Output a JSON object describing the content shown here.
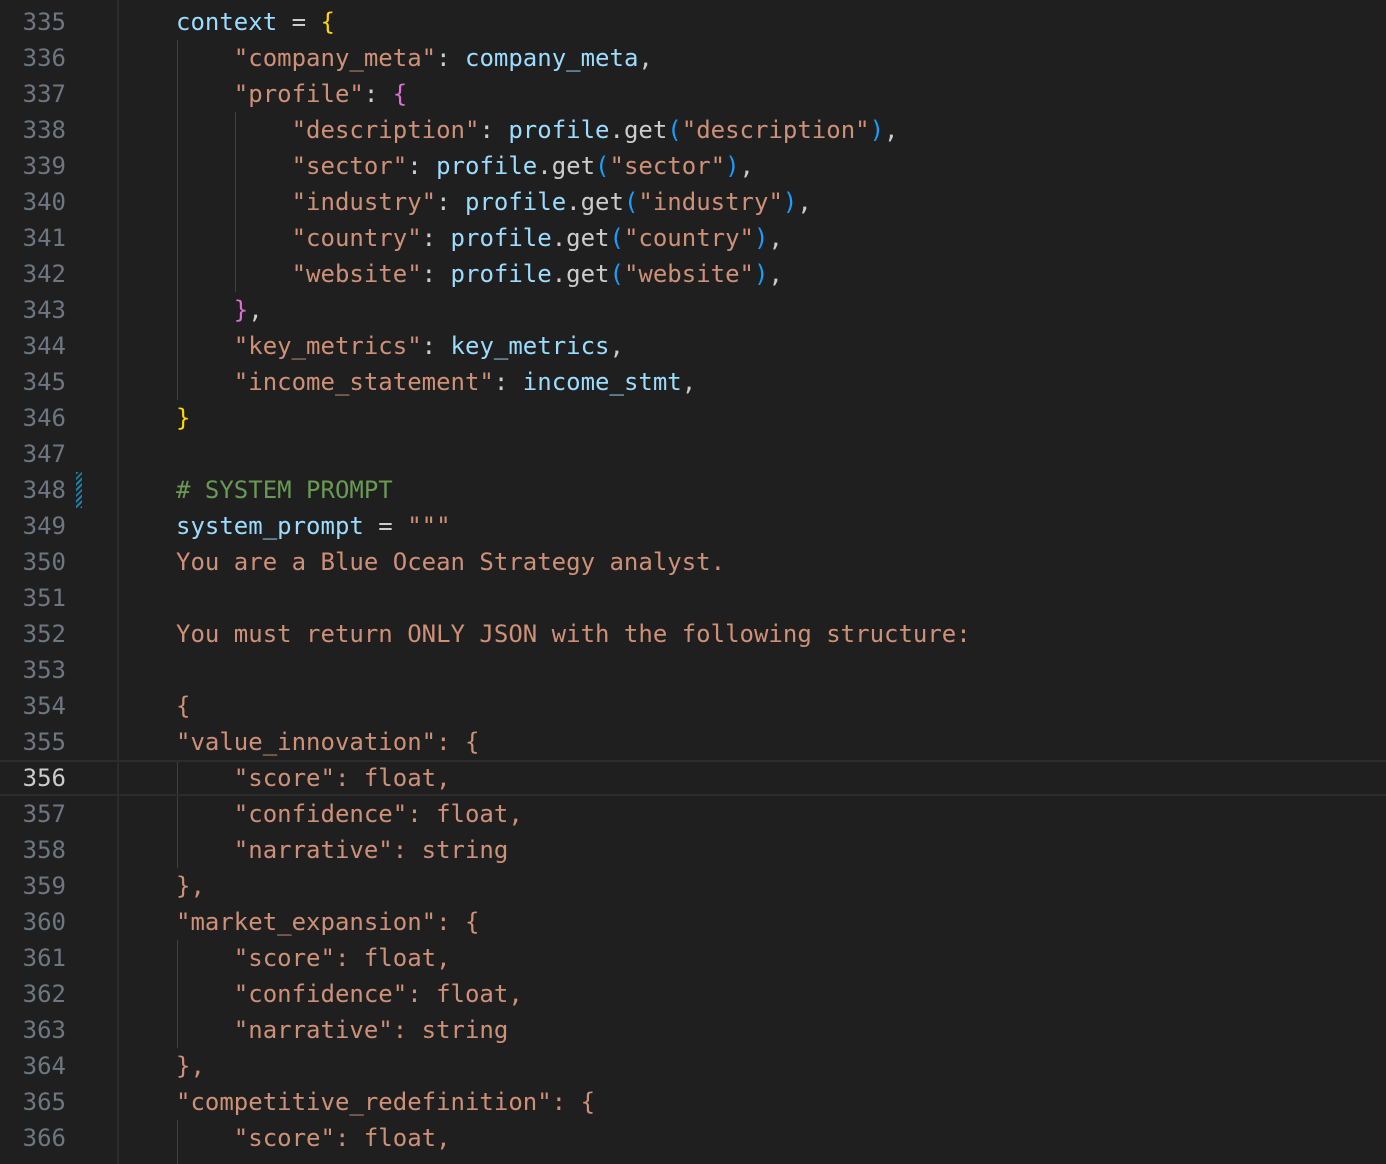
{
  "editor": {
    "language": "python",
    "current_line": 356,
    "modified_line": 348,
    "colors": {
      "background": "#1f1f1f",
      "line_number": "#6e7681",
      "active_line_number": "#cccccc",
      "variable": "#9cdcfe",
      "string": "#ce9178",
      "punctuation": "#cccccc",
      "bracket_level_1": "#ffd700",
      "bracket_level_2": "#da70d6",
      "bracket_level_3": "#179fff",
      "comment": "#6a9955",
      "modified_marker": "#1b81a8"
    },
    "lines": [
      {
        "number": "335",
        "tokens": [
          {
            "text": "context",
            "type": "v"
          },
          {
            "text": " = ",
            "type": "p"
          },
          {
            "text": "{",
            "type": "b1"
          }
        ]
      },
      {
        "number": "336",
        "tokens": [
          {
            "text": "    ",
            "type": "p"
          },
          {
            "text": "\"company_meta\"",
            "type": "s"
          },
          {
            "text": ": ",
            "type": "p"
          },
          {
            "text": "company_meta",
            "type": "v"
          },
          {
            "text": ",",
            "type": "p"
          }
        ]
      },
      {
        "number": "337",
        "tokens": [
          {
            "text": "    ",
            "type": "p"
          },
          {
            "text": "\"profile\"",
            "type": "s"
          },
          {
            "text": ": ",
            "type": "p"
          },
          {
            "text": "{",
            "type": "b2"
          }
        ]
      },
      {
        "number": "338",
        "tokens": [
          {
            "text": "        ",
            "type": "p"
          },
          {
            "text": "\"description\"",
            "type": "s"
          },
          {
            "text": ": ",
            "type": "p"
          },
          {
            "text": "profile",
            "type": "v"
          },
          {
            "text": ".get",
            "type": "p"
          },
          {
            "text": "(",
            "type": "b3"
          },
          {
            "text": "\"description\"",
            "type": "s"
          },
          {
            "text": ")",
            "type": "b3"
          },
          {
            "text": ",",
            "type": "p"
          }
        ]
      },
      {
        "number": "339",
        "tokens": [
          {
            "text": "        ",
            "type": "p"
          },
          {
            "text": "\"sector\"",
            "type": "s"
          },
          {
            "text": ": ",
            "type": "p"
          },
          {
            "text": "profile",
            "type": "v"
          },
          {
            "text": ".get",
            "type": "p"
          },
          {
            "text": "(",
            "type": "b3"
          },
          {
            "text": "\"sector\"",
            "type": "s"
          },
          {
            "text": ")",
            "type": "b3"
          },
          {
            "text": ",",
            "type": "p"
          }
        ]
      },
      {
        "number": "340",
        "tokens": [
          {
            "text": "        ",
            "type": "p"
          },
          {
            "text": "\"industry\"",
            "type": "s"
          },
          {
            "text": ": ",
            "type": "p"
          },
          {
            "text": "profile",
            "type": "v"
          },
          {
            "text": ".get",
            "type": "p"
          },
          {
            "text": "(",
            "type": "b3"
          },
          {
            "text": "\"industry\"",
            "type": "s"
          },
          {
            "text": ")",
            "type": "b3"
          },
          {
            "text": ",",
            "type": "p"
          }
        ]
      },
      {
        "number": "341",
        "tokens": [
          {
            "text": "        ",
            "type": "p"
          },
          {
            "text": "\"country\"",
            "type": "s"
          },
          {
            "text": ": ",
            "type": "p"
          },
          {
            "text": "profile",
            "type": "v"
          },
          {
            "text": ".get",
            "type": "p"
          },
          {
            "text": "(",
            "type": "b3"
          },
          {
            "text": "\"country\"",
            "type": "s"
          },
          {
            "text": ")",
            "type": "b3"
          },
          {
            "text": ",",
            "type": "p"
          }
        ]
      },
      {
        "number": "342",
        "tokens": [
          {
            "text": "        ",
            "type": "p"
          },
          {
            "text": "\"website\"",
            "type": "s"
          },
          {
            "text": ": ",
            "type": "p"
          },
          {
            "text": "profile",
            "type": "v"
          },
          {
            "text": ".get",
            "type": "p"
          },
          {
            "text": "(",
            "type": "b3"
          },
          {
            "text": "\"website\"",
            "type": "s"
          },
          {
            "text": ")",
            "type": "b3"
          },
          {
            "text": ",",
            "type": "p"
          }
        ]
      },
      {
        "number": "343",
        "tokens": [
          {
            "text": "    ",
            "type": "p"
          },
          {
            "text": "}",
            "type": "b2"
          },
          {
            "text": ",",
            "type": "p"
          }
        ]
      },
      {
        "number": "344",
        "tokens": [
          {
            "text": "    ",
            "type": "p"
          },
          {
            "text": "\"key_metrics\"",
            "type": "s"
          },
          {
            "text": ": ",
            "type": "p"
          },
          {
            "text": "key_metrics",
            "type": "v"
          },
          {
            "text": ",",
            "type": "p"
          }
        ]
      },
      {
        "number": "345",
        "tokens": [
          {
            "text": "    ",
            "type": "p"
          },
          {
            "text": "\"income_statement\"",
            "type": "s"
          },
          {
            "text": ": ",
            "type": "p"
          },
          {
            "text": "income_stmt",
            "type": "v"
          },
          {
            "text": ",",
            "type": "p"
          }
        ]
      },
      {
        "number": "346",
        "tokens": [
          {
            "text": "}",
            "type": "b1"
          }
        ]
      },
      {
        "number": "347",
        "tokens": []
      },
      {
        "number": "348",
        "tokens": [
          {
            "text": "# SYSTEM PROMPT",
            "type": "cm"
          }
        ]
      },
      {
        "number": "349",
        "tokens": [
          {
            "text": "system_prompt",
            "type": "v"
          },
          {
            "text": " = ",
            "type": "p"
          },
          {
            "text": "\"\"\"",
            "type": "s"
          }
        ]
      },
      {
        "number": "350",
        "tokens": [
          {
            "text": "You are a Blue Ocean Strategy analyst.",
            "type": "s"
          }
        ]
      },
      {
        "number": "351",
        "tokens": []
      },
      {
        "number": "352",
        "tokens": [
          {
            "text": "You must return ONLY JSON with the following structure:",
            "type": "s"
          }
        ]
      },
      {
        "number": "353",
        "tokens": []
      },
      {
        "number": "354",
        "tokens": [
          {
            "text": "{",
            "type": "s"
          }
        ]
      },
      {
        "number": "355",
        "tokens": [
          {
            "text": "\"value_innovation\": {",
            "type": "s"
          }
        ]
      },
      {
        "number": "356",
        "tokens": [
          {
            "text": "    \"score\": float,",
            "type": "s"
          }
        ]
      },
      {
        "number": "357",
        "tokens": [
          {
            "text": "    \"confidence\": float,",
            "type": "s"
          }
        ]
      },
      {
        "number": "358",
        "tokens": [
          {
            "text": "    \"narrative\": string",
            "type": "s"
          }
        ]
      },
      {
        "number": "359",
        "tokens": [
          {
            "text": "},",
            "type": "s"
          }
        ]
      },
      {
        "number": "360",
        "tokens": [
          {
            "text": "\"market_expansion\": {",
            "type": "s"
          }
        ]
      },
      {
        "number": "361",
        "tokens": [
          {
            "text": "    \"score\": float,",
            "type": "s"
          }
        ]
      },
      {
        "number": "362",
        "tokens": [
          {
            "text": "    \"confidence\": float,",
            "type": "s"
          }
        ]
      },
      {
        "number": "363",
        "tokens": [
          {
            "text": "    \"narrative\": string",
            "type": "s"
          }
        ]
      },
      {
        "number": "364",
        "tokens": [
          {
            "text": "},",
            "type": "s"
          }
        ]
      },
      {
        "number": "365",
        "tokens": [
          {
            "text": "\"competitive_redefinition\": {",
            "type": "s"
          }
        ]
      },
      {
        "number": "366",
        "tokens": [
          {
            "text": "    \"score\": float,",
            "type": "s"
          }
        ]
      }
    ]
  }
}
